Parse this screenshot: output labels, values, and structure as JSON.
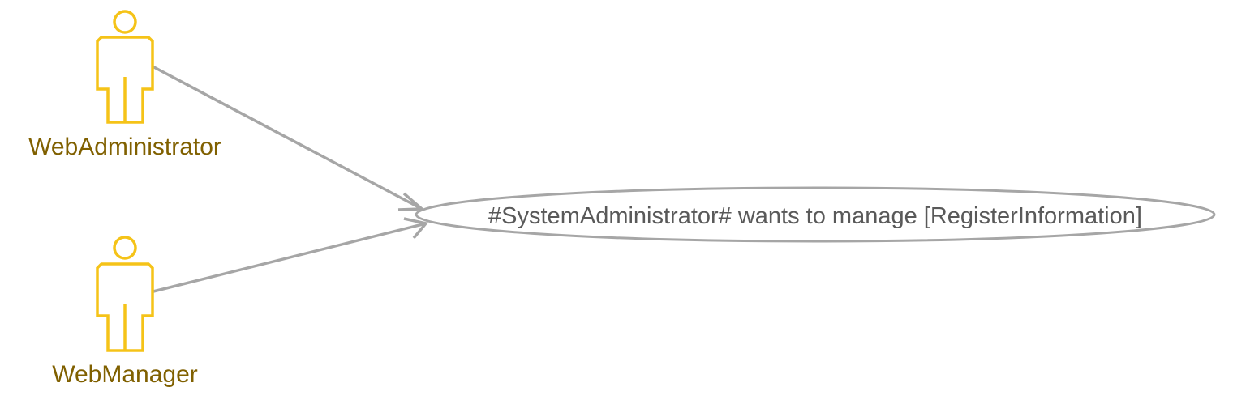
{
  "diagram": {
    "type": "use-case",
    "actors": [
      {
        "id": "web-administrator",
        "label": "WebAdministrator"
      },
      {
        "id": "web-manager",
        "label": "WebManager"
      }
    ],
    "use_cases": [
      {
        "id": "manage-register-information",
        "label": "#SystemAdministrator# wants to manage [RegisterInformation]"
      }
    ],
    "associations": [
      {
        "from": "web-administrator",
        "to": "manage-register-information"
      },
      {
        "from": "web-manager",
        "to": "manage-register-information"
      }
    ]
  },
  "colors": {
    "actor_stroke": "#F5C318",
    "actor_label": "#806000",
    "connector": "#A6A6A6",
    "usecase_stroke": "#A6A6A6",
    "usecase_label": "#595959",
    "background": "#FFFFFF"
  }
}
